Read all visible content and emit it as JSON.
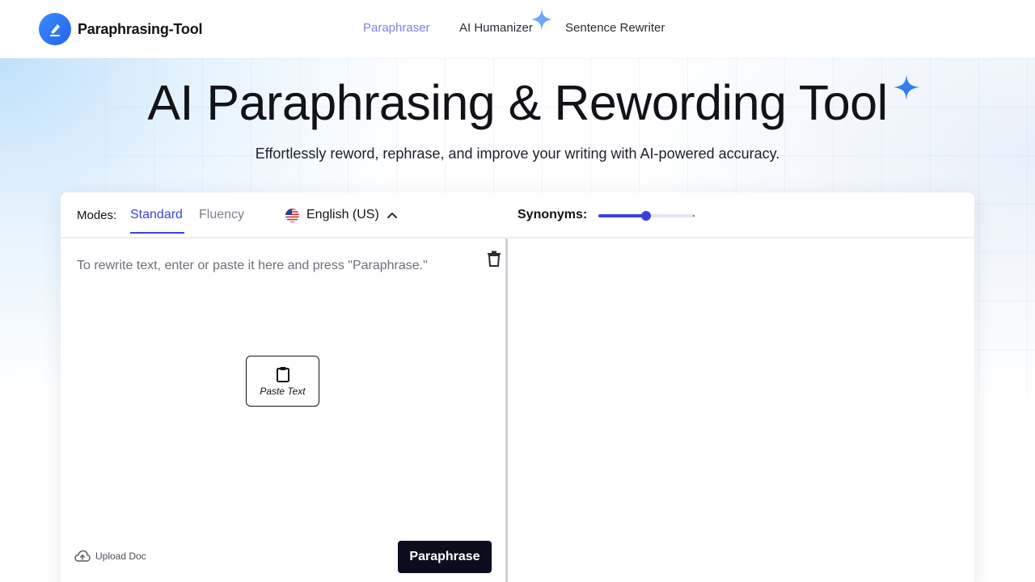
{
  "brand": {
    "name": "Paraphrasing-Tool",
    "accent": "#2563eb"
  },
  "nav": {
    "items": [
      {
        "label": "Paraphraser",
        "active": true
      },
      {
        "label": "AI Humanizer",
        "active": false
      },
      {
        "label": "Sentence Rewriter",
        "active": false
      }
    ]
  },
  "hero": {
    "title": "AI Paraphrasing & Rewording Tool",
    "subtitle": "Effortlessly reword, rephrase, and improve your writing with AI-powered accuracy."
  },
  "toolbar": {
    "modes_label": "Modes:",
    "modes": [
      {
        "label": "Standard",
        "selected": true
      },
      {
        "label": "Fluency",
        "selected": false
      }
    ],
    "language": "English (US)",
    "synonyms_label": "Synonyms:",
    "synonyms_level": 0.5
  },
  "editor": {
    "placeholder": "To rewrite text, enter or paste it here and press \"Paraphrase.\"",
    "paste_label": "Paste Text",
    "upload_label": "Upload Doc",
    "paraphrase_label": "Paraphrase"
  },
  "icons": {
    "logo": "pencil-logo-icon",
    "nav_spark": "sparkle-icon",
    "title_spark": "sparkle-icon",
    "flag": "us-flag-icon",
    "chevron": "chevron-up-icon",
    "trash": "trash-icon",
    "clipboard": "clipboard-icon",
    "upload": "cloud-upload-icon"
  },
  "colors": {
    "active_tab": "#3c45d6",
    "nav_active": "#7b83eb",
    "button_dark": "#0b0d1f",
    "spark": "#3b82f6"
  }
}
